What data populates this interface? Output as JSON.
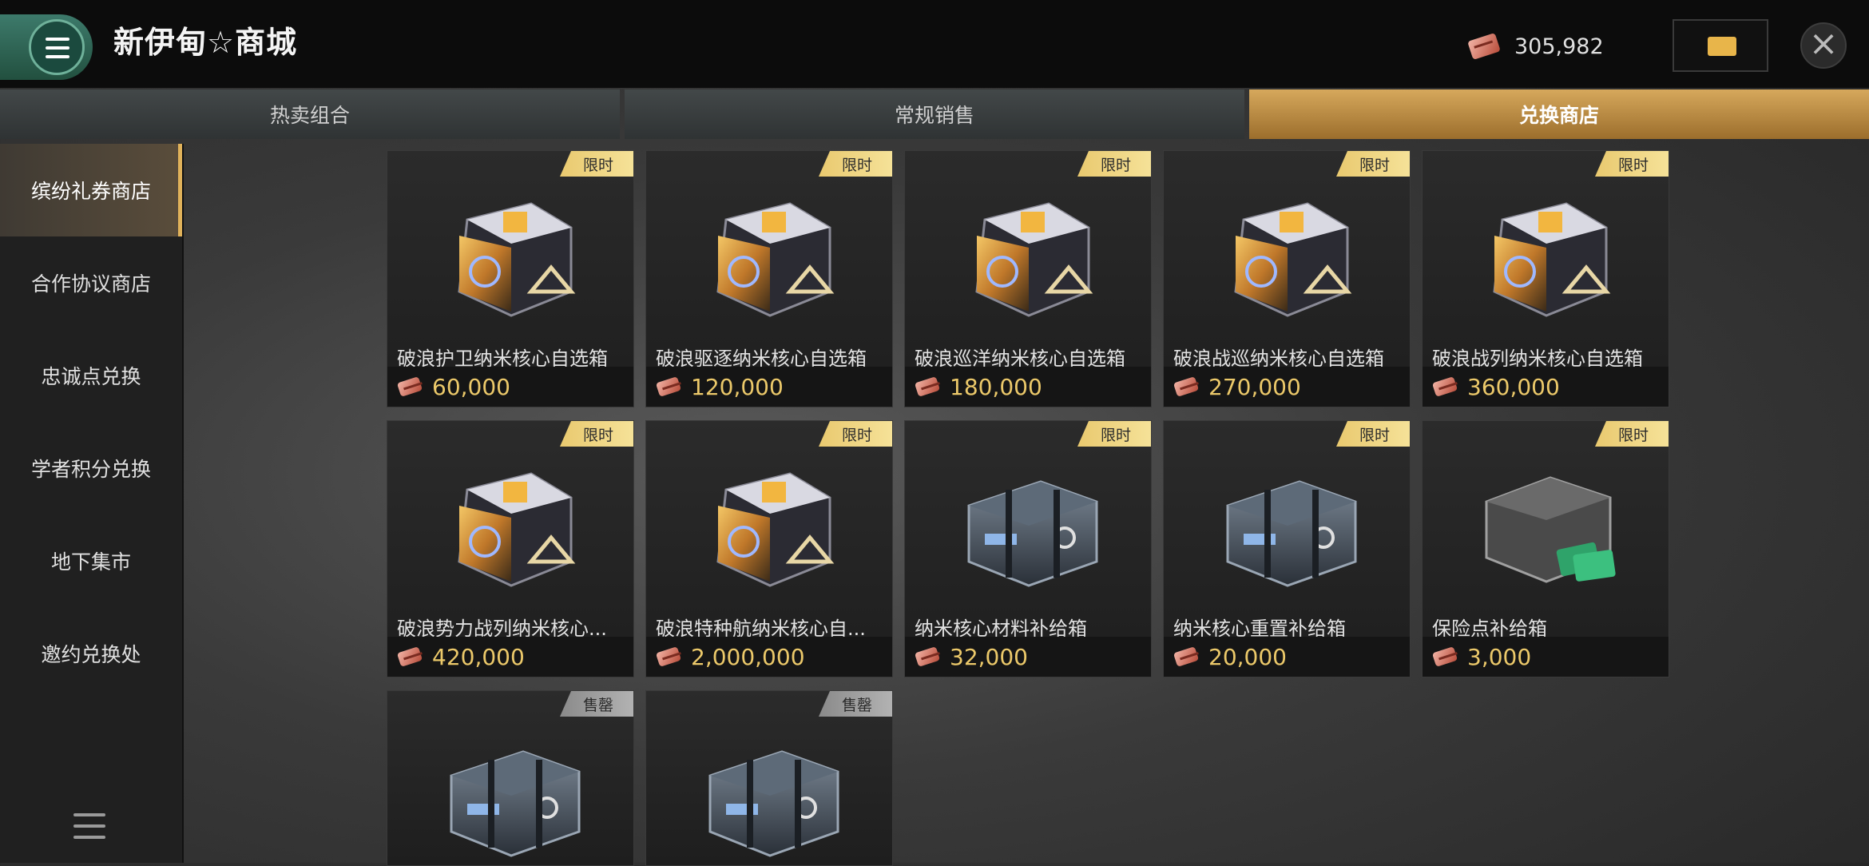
{
  "app": {
    "title": "新伊甸☆商城"
  },
  "header": {
    "currency_value": "305,982"
  },
  "tabs": [
    {
      "label": "热卖组合"
    },
    {
      "label": "常规销售"
    },
    {
      "label": "兑换商店",
      "active": true
    }
  ],
  "sidebar": {
    "items": [
      {
        "label": "缤纷礼券商店",
        "active": true
      },
      {
        "label": "合作协议商店"
      },
      {
        "label": "忠诚点兑换"
      },
      {
        "label": "学者积分兑换"
      },
      {
        "label": "地下集市"
      },
      {
        "label": "邀约兑换处"
      }
    ]
  },
  "items": [
    {
      "tag": "限时",
      "name": "破浪护卫纳米核心自选箱",
      "price": "60,000",
      "art": "nano-core-cube-icon"
    },
    {
      "tag": "限时",
      "name": "破浪驱逐纳米核心自选箱",
      "price": "120,000",
      "art": "nano-core-cube-icon"
    },
    {
      "tag": "限时",
      "name": "破浪巡洋纳米核心自选箱",
      "price": "180,000",
      "art": "nano-core-cube-icon"
    },
    {
      "tag": "限时",
      "name": "破浪战巡纳米核心自选箱",
      "price": "270,000",
      "art": "nano-core-cube-icon"
    },
    {
      "tag": "限时",
      "name": "破浪战列纳米核心自选箱",
      "price": "360,000",
      "art": "nano-core-cube-icon"
    },
    {
      "tag": "限时",
      "name": "破浪势力战列纳米核心...",
      "price": "420,000",
      "art": "nano-core-cube-icon"
    },
    {
      "tag": "限时",
      "name": "破浪特种航纳米核心自...",
      "price": "2,000,000",
      "art": "nano-core-cube-icon"
    },
    {
      "tag": "限时",
      "name": "纳米核心材料补给箱",
      "price": "32,000",
      "art": "supply-crate-icon"
    },
    {
      "tag": "限时",
      "name": "纳米核心重置补给箱",
      "price": "20,000",
      "art": "supply-crate-icon"
    },
    {
      "tag": "限时",
      "name": "保险点补给箱",
      "price": "3,000",
      "art": "insurance-crate-icon"
    },
    {
      "tag": "售罄",
      "name": "",
      "price": "",
      "art": "supply-crate-icon"
    },
    {
      "tag": "售罄",
      "name": "",
      "price": "",
      "art": "supply-crate-icon"
    }
  ],
  "colors": {
    "accent_gold": "#e0b25a",
    "price": "#ecc96a",
    "menu_green": "#3d7a6b"
  }
}
